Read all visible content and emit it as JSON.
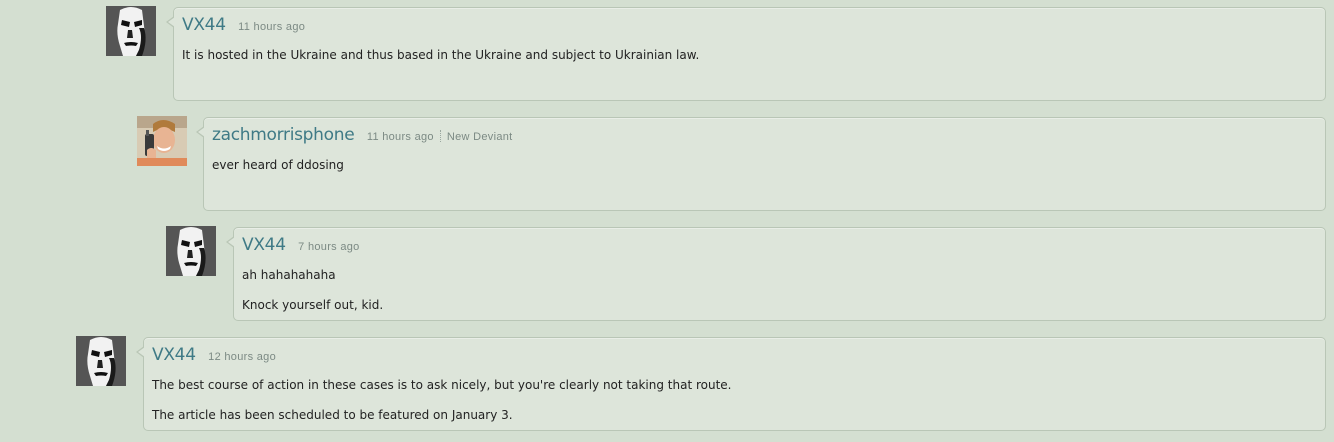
{
  "comments": [
    {
      "username": "VX44",
      "time": "11 hours ago",
      "lines": [
        "It is hosted in the Ukraine and thus based in the Ukraine and subject to Ukrainian law."
      ]
    },
    {
      "username": "zachmorrisphone",
      "time": "11 hours ago",
      "badge": "New Deviant",
      "lines": [
        "ever heard of ddosing"
      ]
    },
    {
      "username": "VX44",
      "time": "7 hours ago",
      "lines": [
        "ah hahahahaha",
        "Knock yourself out, kid."
      ]
    },
    {
      "username": "VX44",
      "time": "12 hours ago",
      "lines": [
        "The best course of action in these cases is to ask nicely, but you're clearly not taking that route.",
        "The article has been scheduled to be featured on January 3."
      ]
    }
  ]
}
